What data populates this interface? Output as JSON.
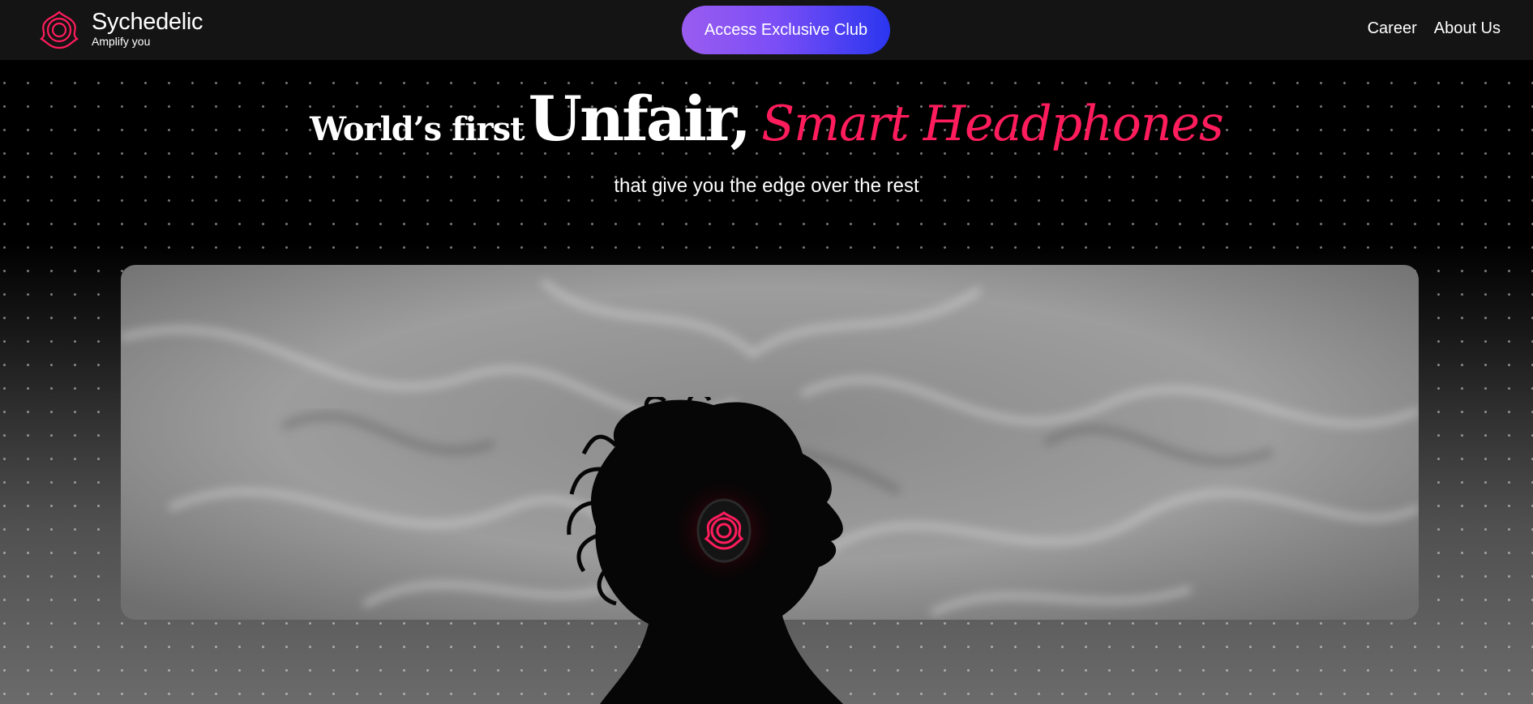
{
  "brand": {
    "name": "Sychedelic",
    "tagline": "Amplify you",
    "logo_icon": "flower-knot-icon",
    "accent": "#ff1c5c"
  },
  "header": {
    "cta_label": "Access Exclusive Club",
    "nav": [
      {
        "label": "Career"
      },
      {
        "label": "About Us"
      }
    ]
  },
  "hero": {
    "title_prefix": "World’s first",
    "title_emphasis": "Unfair,",
    "title_script": "Smart Headphones",
    "subtitle": "that give you the edge over the rest",
    "image": "grayscale smoke background with silhouette wearing headphones"
  },
  "colors": {
    "background": "#000000",
    "header_bg": "#141414",
    "cta_start": "#9a5cf0",
    "cta_end": "#2a36ef",
    "script": "#ff1c5c"
  }
}
